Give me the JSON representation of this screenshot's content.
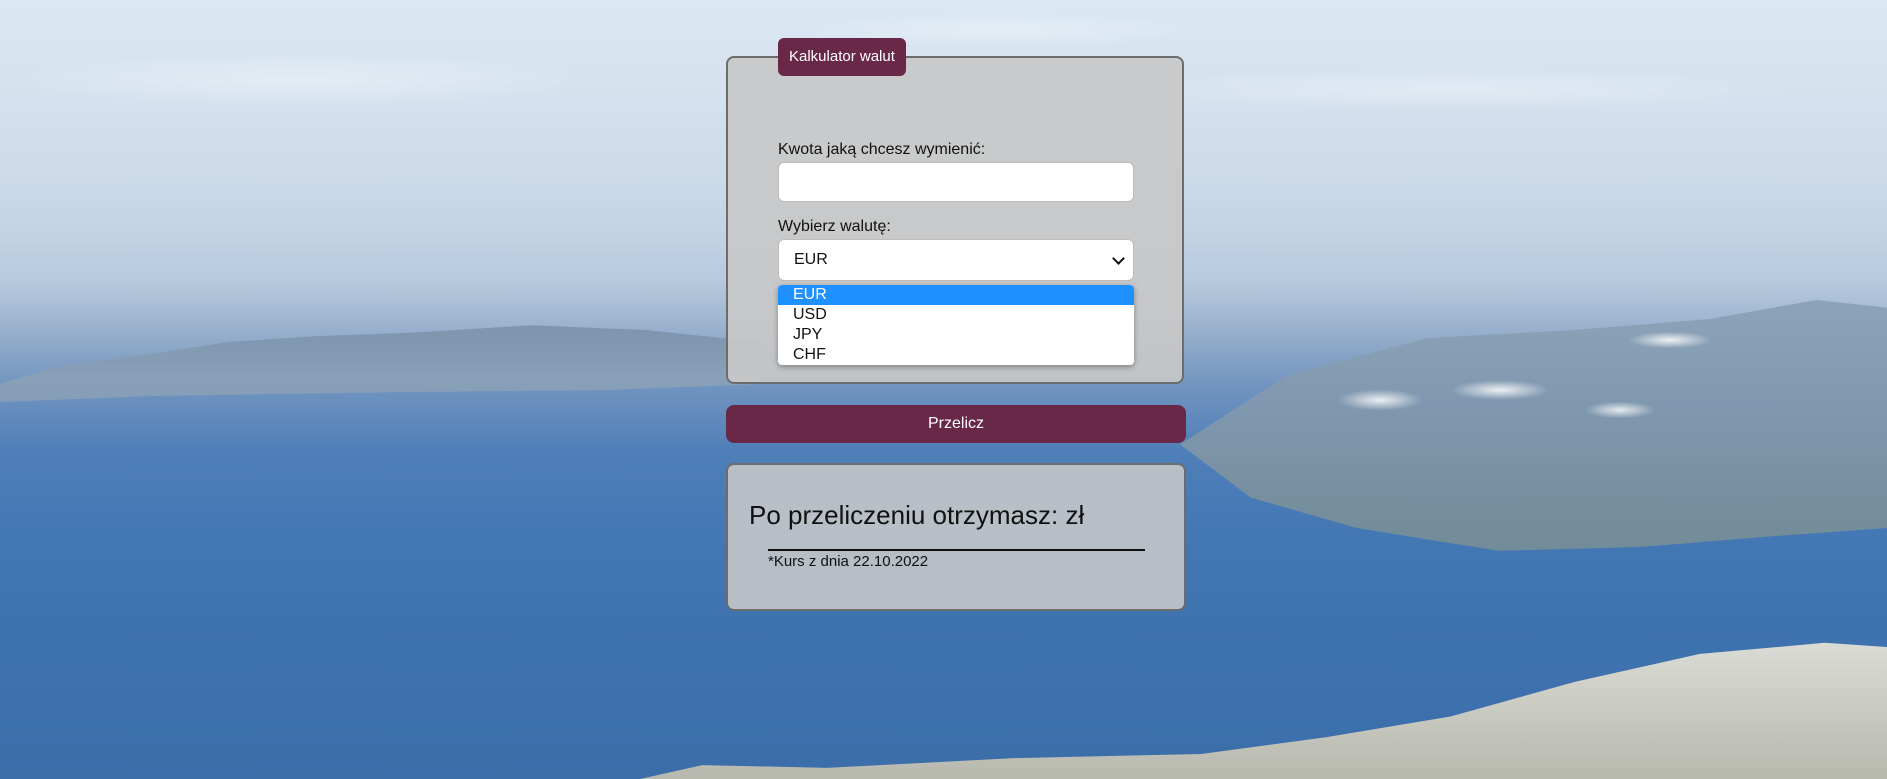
{
  "calculator": {
    "legend": "Kalkulator walut",
    "amount_label": "Kwota jaką chcesz wymienić:",
    "amount_value": "",
    "currency_label": "Wybierz walutę:",
    "selected_currency": "EUR",
    "currency_options": [
      "EUR",
      "USD",
      "JPY",
      "CHF"
    ],
    "convert_button": "Przelicz"
  },
  "result": {
    "prefix": "Po przeliczeniu otrzymasz:",
    "amount": "",
    "currency_suffix": "zł",
    "rate_note": "*Kurs z dnia 22.10.2022"
  },
  "colors": {
    "accent": "#6a2849",
    "selected_option": "#1e90ff"
  }
}
